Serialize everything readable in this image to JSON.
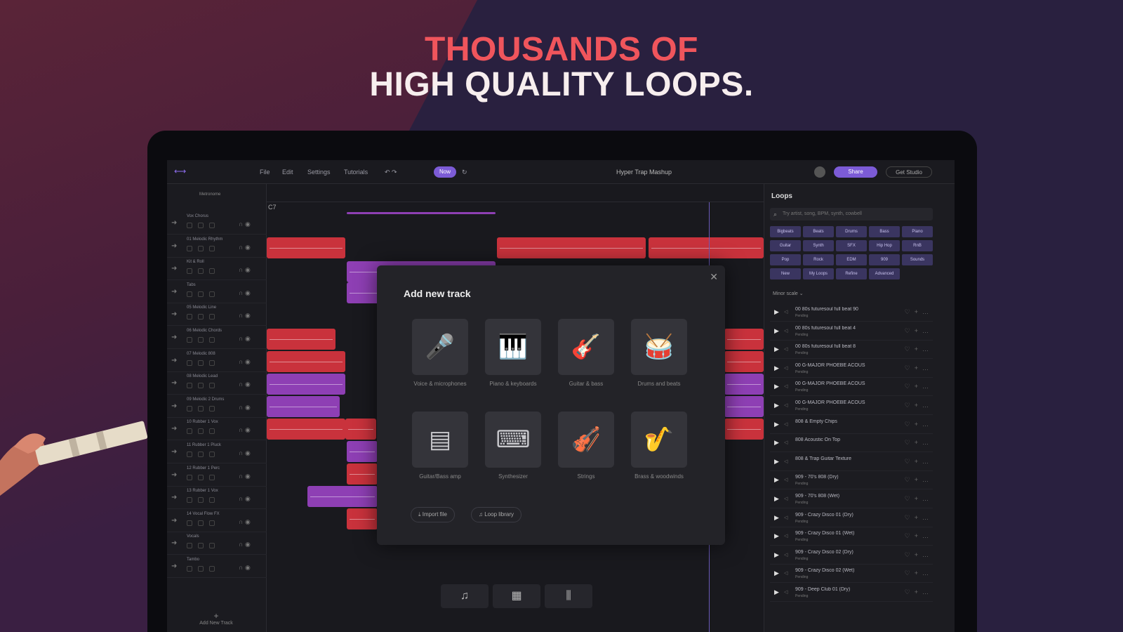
{
  "hero": {
    "line1": "THOUSANDS OF",
    "line2": "HIGH QUALITY LOOPS."
  },
  "colors": {
    "accent": "#8f6ef0",
    "clip_red": "#c9323c",
    "clip_purple": "#8e3fb4",
    "hero_red": "#f0555c"
  },
  "topbar": {
    "menu": [
      "File",
      "Edit",
      "Settings",
      "Tutorials"
    ],
    "mode_pill": "Now",
    "project_title": "Hyper Trap Mashup",
    "share_button": "Share",
    "cta_button": "Get Studio"
  },
  "tracks": {
    "header": "Metronome",
    "names": [
      "Vox Chorus",
      "01 Melodic Rhythm",
      "Kit & Roll",
      "Tabs",
      "05 Melodic Line",
      "06 Melodic Chords",
      "07 Melodic 808",
      "08 Melodic Lead",
      "09 Melodic 2 Drums",
      "10 Rubber 1 Vox",
      "11 Rubber 1 Pluck",
      "12 Rubber 1 Perc",
      "13 Rubber 1 Vox",
      "14 Vocal Flow FX",
      "Vocals",
      "Tambo"
    ],
    "add_track": "Add New Track"
  },
  "ruler": {
    "marker": "C7"
  },
  "modal": {
    "title": "Add new track",
    "options": [
      {
        "label": "Voice & microphones",
        "icon": "microphone-icon"
      },
      {
        "label": "Piano & keyboards",
        "icon": "piano-icon"
      },
      {
        "label": "Guitar & bass",
        "icon": "guitar-icon"
      },
      {
        "label": "Drums and beats",
        "icon": "drum-kit-icon"
      },
      {
        "label": "Guitar/Bass amp",
        "icon": "amp-icon"
      },
      {
        "label": "Synthesizer",
        "icon": "synthesizer-icon"
      },
      {
        "label": "Strings",
        "icon": "violin-icon"
      },
      {
        "label": "Brass & woodwinds",
        "icon": "brass-icon"
      }
    ],
    "import_button": "Import file",
    "loop_library_button": "Loop library"
  },
  "loops": {
    "title": "Loops",
    "search_placeholder": "Try artist, song, BPM, synth, cowbell",
    "tags": [
      "Bigbeats",
      "Beats",
      "Drums",
      "Bass",
      "Piano",
      "Guitar",
      "Synth",
      "SFX",
      "Hip Hop",
      "RnB",
      "Pop",
      "Rock",
      "EDM",
      "909",
      "Sounds",
      "New",
      "My Loops",
      "Refine",
      "Advanced"
    ],
    "sort": "Minor scale",
    "items": [
      {
        "name": "00 80s futuresoul full beat 90",
        "status": "Pending"
      },
      {
        "name": "00 80s futuresoul full beat 4",
        "status": "Pending"
      },
      {
        "name": "00 80s futuresoul full beat 8",
        "status": "Pending"
      },
      {
        "name": "00 G-MAJOR PHOEBE ACOUS",
        "status": "Pending"
      },
      {
        "name": "00 G-MAJOR PHOEBE ACOUS",
        "status": "Pending"
      },
      {
        "name": "00 G-MAJOR PHOEBE ACOUS",
        "status": "Pending"
      },
      {
        "name": "808 & Empty Chips",
        "status": ""
      },
      {
        "name": "808 Acoustic On Top",
        "status": ""
      },
      {
        "name": "808 & Trap Guitar Texture",
        "status": ""
      },
      {
        "name": "909 - 70's 808 (Dry)",
        "status": "Pending"
      },
      {
        "name": "909 - 70's 808 (Wet)",
        "status": "Pending"
      },
      {
        "name": "909 - Crazy Disco 01 (Dry)",
        "status": "Pending"
      },
      {
        "name": "909 - Crazy Disco 01 (Wet)",
        "status": "Pending"
      },
      {
        "name": "909 - Crazy Disco 02 (Dry)",
        "status": "Pending"
      },
      {
        "name": "909 - Crazy Disco 02 (Wet)",
        "status": "Pending"
      },
      {
        "name": "909 - Deep Club 01 (Dry)",
        "status": "Pending"
      }
    ]
  },
  "bottombar": {
    "icons": [
      "music-note-icon",
      "keyboard-icon",
      "mixer-icon"
    ]
  }
}
